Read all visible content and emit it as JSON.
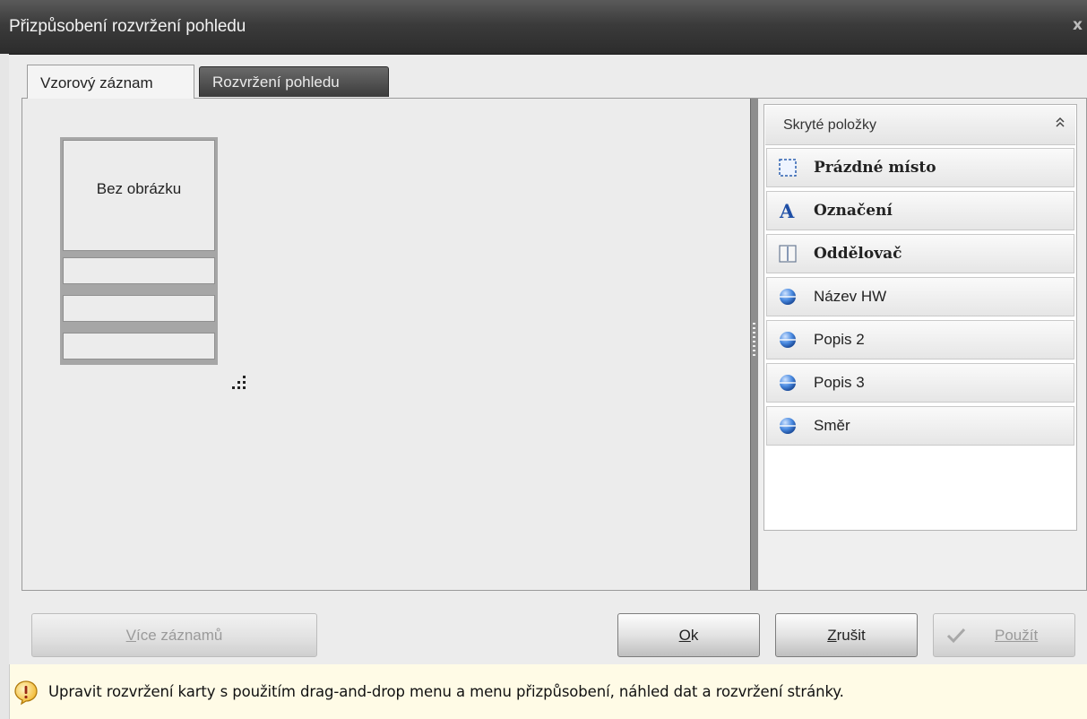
{
  "window": {
    "title": "Přizpůsobení rozvržení pohledu",
    "close_label": "x"
  },
  "tabs": [
    {
      "label": "Vzorový záznam",
      "active": true
    },
    {
      "label": "Rozvržení pohledu",
      "active": false
    }
  ],
  "card": {
    "image_placeholder": "Bez obrázku"
  },
  "hidden_items": {
    "header": "Skryté položky",
    "items": [
      {
        "label": "Prázdné místo",
        "icon": "empty-space-icon",
        "bold": true
      },
      {
        "label": "Označení",
        "icon": "label-a-icon",
        "bold": true
      },
      {
        "label": "Oddělovač",
        "icon": "separator-icon",
        "bold": true
      },
      {
        "label": "Název HW",
        "icon": "field-sphere-icon",
        "bold": false
      },
      {
        "label": "Popis 2",
        "icon": "field-sphere-icon",
        "bold": false
      },
      {
        "label": "Popis 3",
        "icon": "field-sphere-icon",
        "bold": false
      },
      {
        "label": "Směr",
        "icon": "field-sphere-icon",
        "bold": false
      }
    ]
  },
  "buttons": {
    "more_records": {
      "mnemonic": "V",
      "rest": "íce záznamů"
    },
    "ok": {
      "mnemonic": "O",
      "rest": "k"
    },
    "cancel": {
      "mnemonic": "Z",
      "rest": "rušit"
    },
    "apply": {
      "mnemonic": "",
      "rest": "Použít"
    }
  },
  "status": {
    "text": "Upravit rozvržení karty s použitím drag-and-drop menu a menu přizpůsobení, náhled dat a rozvržení stránky."
  },
  "colors": {
    "title_bar": "#3b3b3b",
    "status_bg": "#fffbe6",
    "sphere_blue": "#3a7fd6",
    "status_icon": "#e0a31c"
  }
}
